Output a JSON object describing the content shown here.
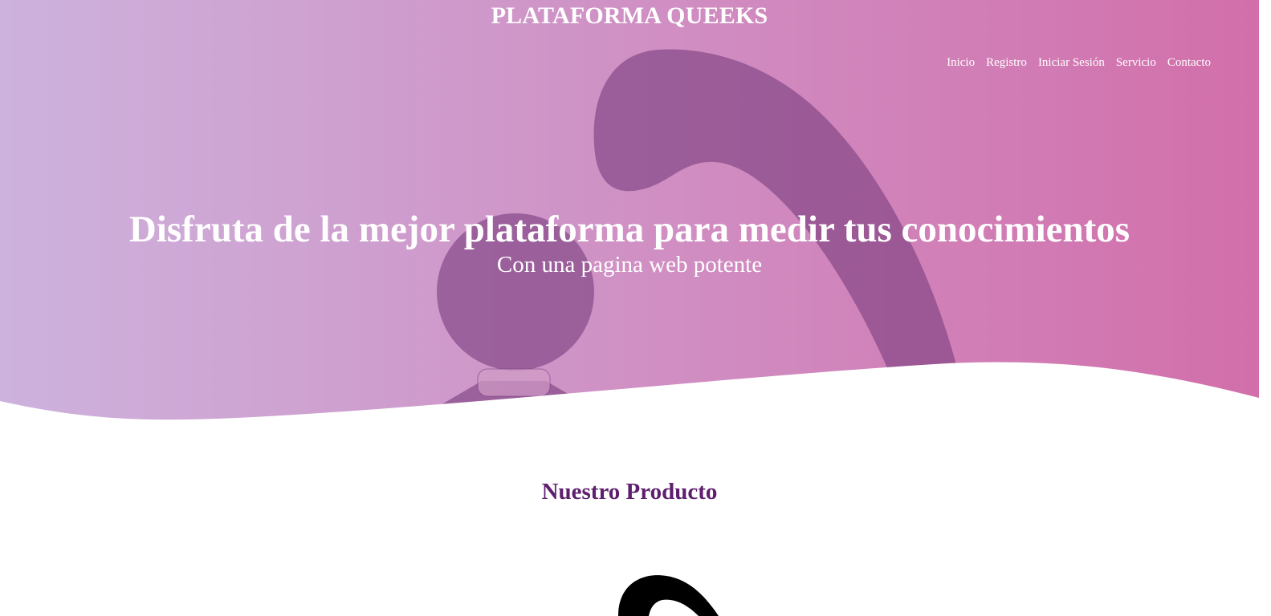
{
  "header": {
    "brand": "PLATAFORMA QUEEKS"
  },
  "nav": {
    "items": [
      {
        "label": "Inicio"
      },
      {
        "label": "Registro"
      },
      {
        "label": "Iniciar Sesión"
      },
      {
        "label": "Servicio"
      },
      {
        "label": "Contacto"
      }
    ]
  },
  "hero": {
    "title": "Disfruta de la mejor plataforma para medir tus conocimientos",
    "subtitle": "Con una pagina web potente"
  },
  "products": {
    "title": "Nuestro Producto"
  },
  "colors": {
    "gradient_start": "#cdb2dd",
    "gradient_end": "#d26eaa",
    "illustration": "#7a3f7f",
    "section_title": "#5e1f6e"
  }
}
